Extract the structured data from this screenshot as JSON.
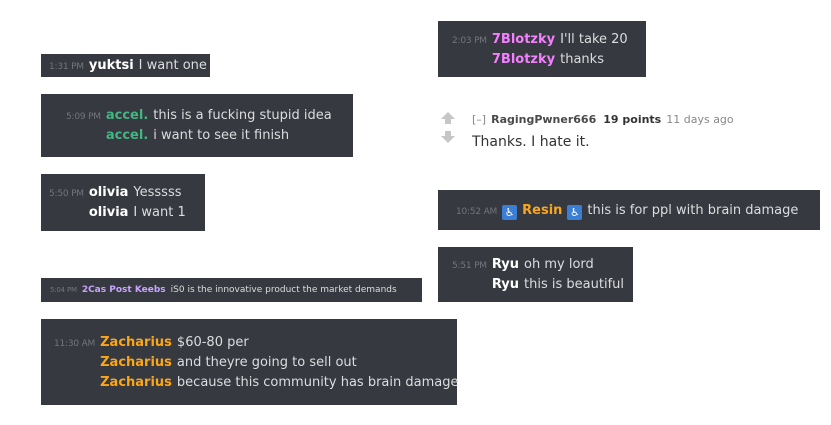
{
  "colors": {
    "background": "#36393f",
    "message_text": "#dcddde",
    "timestamp": "#72767d",
    "white_user": "#ffffff",
    "green_user": "#43b581",
    "pink_user": "#f47fff",
    "orange_user": "#faa61a",
    "lavender_user": "#c9a4ff",
    "role_icon": "#3b7ed6"
  },
  "discord_boxes": [
    {
      "id": "yuktsi",
      "lines": [
        {
          "time": "1:31 PM",
          "user": "yuktsi",
          "text": "I want one"
        }
      ]
    },
    {
      "id": "accel",
      "lines": [
        {
          "time": "5:09 PM",
          "user": "accel.",
          "text": "this is a fucking stupid idea"
        },
        {
          "time": "",
          "user": "accel.",
          "text": "i want to see it finish"
        }
      ]
    },
    {
      "id": "olivia",
      "lines": [
        {
          "time": "5:50 PM",
          "user": "olivia",
          "text": "Yesssss"
        },
        {
          "time": "",
          "user": "olivia",
          "text": "I want 1"
        }
      ]
    },
    {
      "id": "2cas",
      "lines": [
        {
          "time": "5:04 PM",
          "user": "2Cas Post Keebs",
          "text": "iS0 is the innovative product the market demands"
        }
      ]
    },
    {
      "id": "zacharius",
      "lines": [
        {
          "time": "11:30 AM",
          "user": "Zacharius",
          "text": "$60-80 per"
        },
        {
          "time": "",
          "user": "Zacharius",
          "text": "and theyre going to sell out"
        },
        {
          "time": "",
          "user": "Zacharius",
          "text": "because this community has brain damage"
        }
      ]
    },
    {
      "id": "7blotzky",
      "lines": [
        {
          "time": "2:03 PM",
          "user": "7Blotzky",
          "text": "I'll take 20"
        },
        {
          "time": "",
          "user": "7Blotzky",
          "text": "thanks"
        }
      ]
    },
    {
      "id": "resin",
      "lines": [
        {
          "time": "10:52 AM",
          "user": "Resin",
          "icon": "wheelchair-icon",
          "text": "this is for ppl with brain damage"
        }
      ]
    },
    {
      "id": "ryu",
      "lines": [
        {
          "time": "5:51 PM",
          "user": "Ryu",
          "text": "oh my lord"
        },
        {
          "time": "",
          "user": "Ryu",
          "text": "this is beautiful"
        }
      ]
    }
  ],
  "reddit_comment": {
    "collapse": "[–]",
    "username": "RagingPwner666",
    "points": "19 points",
    "age": "11 days ago",
    "body": "Thanks. I hate it.",
    "upvote_icon": "upvote-arrow-icon",
    "downvote_icon": "downvote-arrow-icon"
  }
}
